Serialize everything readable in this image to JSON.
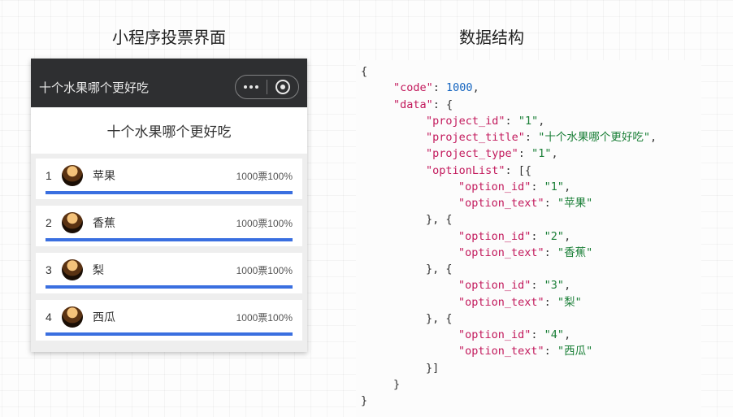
{
  "headings": {
    "left": "小程序投票界面",
    "right": "数据结构"
  },
  "app": {
    "navbar_title": "十个水果哪个更好吃",
    "poll_title": "十个水果哪个更好吃",
    "vote_suffix": "票",
    "options": [
      {
        "rank": "1",
        "name": "苹果",
        "votes_text": "1000票100%",
        "percent": 100
      },
      {
        "rank": "2",
        "name": "香蕉",
        "votes_text": "1000票100%",
        "percent": 100
      },
      {
        "rank": "3",
        "name": "梨",
        "votes_text": "1000票100%",
        "percent": 100
      },
      {
        "rank": "4",
        "name": "西瓜",
        "votes_text": "1000票100%",
        "percent": 100
      }
    ]
  },
  "code": {
    "syntax": "json",
    "value": {
      "code": 1000,
      "data": {
        "project_id": "1",
        "project_title": "十个水果哪个更好吃",
        "project_type": "1",
        "optionList": [
          {
            "option_id": "1",
            "option_text": "苹果"
          },
          {
            "option_id": "2",
            "option_text": "香蕉"
          },
          {
            "option_id": "3",
            "option_text": "梨"
          },
          {
            "option_id": "4",
            "option_text": "西瓜"
          }
        ]
      }
    },
    "lines": [
      {
        "indent": 0,
        "tokens": [
          {
            "t": "p",
            "v": "{"
          }
        ]
      },
      {
        "indent": 1,
        "tokens": [
          {
            "t": "k",
            "v": "\"code\""
          },
          {
            "t": "p",
            "v": ": "
          },
          {
            "t": "n",
            "v": "1000"
          },
          {
            "t": "p",
            "v": ","
          }
        ]
      },
      {
        "indent": 1,
        "tokens": [
          {
            "t": "k",
            "v": "\"data\""
          },
          {
            "t": "p",
            "v": ": {"
          }
        ]
      },
      {
        "indent": 2,
        "tokens": [
          {
            "t": "k",
            "v": "\"project_id\""
          },
          {
            "t": "p",
            "v": ": "
          },
          {
            "t": "s",
            "v": "\"1\""
          },
          {
            "t": "p",
            "v": ","
          }
        ]
      },
      {
        "indent": 2,
        "tokens": [
          {
            "t": "k",
            "v": "\"project_title\""
          },
          {
            "t": "p",
            "v": ": "
          },
          {
            "t": "s",
            "v": "\"十个水果哪个更好吃\""
          },
          {
            "t": "p",
            "v": ","
          }
        ]
      },
      {
        "indent": 2,
        "tokens": [
          {
            "t": "k",
            "v": "\"project_type\""
          },
          {
            "t": "p",
            "v": ": "
          },
          {
            "t": "s",
            "v": "\"1\""
          },
          {
            "t": "p",
            "v": ","
          }
        ]
      },
      {
        "indent": 2,
        "tokens": [
          {
            "t": "k",
            "v": "\"optionList\""
          },
          {
            "t": "p",
            "v": ": [{"
          }
        ]
      },
      {
        "indent": 3,
        "tokens": [
          {
            "t": "k",
            "v": "\"option_id\""
          },
          {
            "t": "p",
            "v": ": "
          },
          {
            "t": "s",
            "v": "\"1\""
          },
          {
            "t": "p",
            "v": ","
          }
        ]
      },
      {
        "indent": 3,
        "tokens": [
          {
            "t": "k",
            "v": "\"option_text\""
          },
          {
            "t": "p",
            "v": ": "
          },
          {
            "t": "s",
            "v": "\"苹果\""
          }
        ]
      },
      {
        "indent": 2,
        "tokens": [
          {
            "t": "p",
            "v": "}, {"
          }
        ]
      },
      {
        "indent": 3,
        "tokens": [
          {
            "t": "k",
            "v": "\"option_id\""
          },
          {
            "t": "p",
            "v": ": "
          },
          {
            "t": "s",
            "v": "\"2\""
          },
          {
            "t": "p",
            "v": ","
          }
        ]
      },
      {
        "indent": 3,
        "tokens": [
          {
            "t": "k",
            "v": "\"option_text\""
          },
          {
            "t": "p",
            "v": ": "
          },
          {
            "t": "s",
            "v": "\"香蕉\""
          }
        ]
      },
      {
        "indent": 2,
        "tokens": [
          {
            "t": "p",
            "v": "}, {"
          }
        ]
      },
      {
        "indent": 3,
        "tokens": [
          {
            "t": "k",
            "v": "\"option_id\""
          },
          {
            "t": "p",
            "v": ": "
          },
          {
            "t": "s",
            "v": "\"3\""
          },
          {
            "t": "p",
            "v": ","
          }
        ]
      },
      {
        "indent": 3,
        "tokens": [
          {
            "t": "k",
            "v": "\"option_text\""
          },
          {
            "t": "p",
            "v": ": "
          },
          {
            "t": "s",
            "v": "\"梨\""
          }
        ]
      },
      {
        "indent": 2,
        "tokens": [
          {
            "t": "p",
            "v": "}, {"
          }
        ]
      },
      {
        "indent": 3,
        "tokens": [
          {
            "t": "k",
            "v": "\"option_id\""
          },
          {
            "t": "p",
            "v": ": "
          },
          {
            "t": "s",
            "v": "\"4\""
          },
          {
            "t": "p",
            "v": ","
          }
        ]
      },
      {
        "indent": 3,
        "tokens": [
          {
            "t": "k",
            "v": "\"option_text\""
          },
          {
            "t": "p",
            "v": ": "
          },
          {
            "t": "s",
            "v": "\"西瓜\""
          }
        ]
      },
      {
        "indent": 2,
        "tokens": [
          {
            "t": "p",
            "v": "}]"
          }
        ]
      },
      {
        "indent": 1,
        "tokens": [
          {
            "t": "p",
            "v": "}"
          }
        ]
      },
      {
        "indent": 0,
        "tokens": [
          {
            "t": "p",
            "v": "}"
          }
        ]
      }
    ]
  }
}
